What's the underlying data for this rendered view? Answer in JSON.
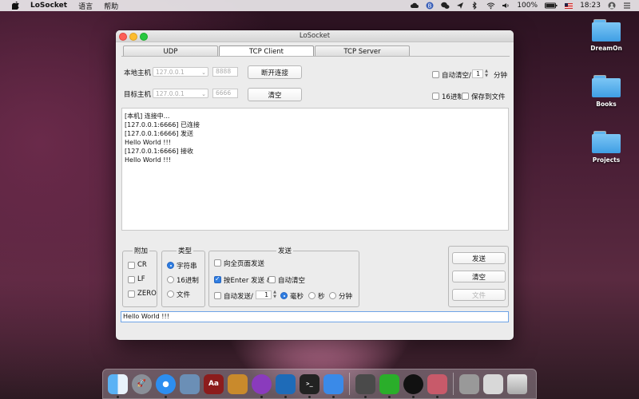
{
  "menubar": {
    "app_name": "LoSocket",
    "menus": [
      "语言",
      "帮助"
    ],
    "battery": "100%",
    "time": "18:23",
    "icons": [
      "apple-icon",
      "cloud-icon",
      "b-icon",
      "wechat-icon",
      "paperplane-icon",
      "bluetooth-icon",
      "wifi-icon",
      "volume-icon",
      "battery-icon",
      "flag-icon",
      "clock-icon",
      "user-icon",
      "list-icon"
    ]
  },
  "desktop": {
    "folders": [
      {
        "label": "DreamOn"
      },
      {
        "label": "Books"
      },
      {
        "label": "Projects"
      }
    ]
  },
  "window": {
    "title": "LoSocket",
    "tabs": [
      {
        "label": "UDP",
        "active": false
      },
      {
        "label": "TCP Client",
        "active": true
      },
      {
        "label": "TCP Server",
        "active": false
      }
    ],
    "local_host": {
      "label": "本地主机",
      "ip": "127.0.0.1",
      "port": "8888",
      "button": "断开连接"
    },
    "target_host": {
      "label": "目标主机",
      "ip": "127.0.0.1",
      "port": "6666",
      "button": "清空"
    },
    "auto_clear": {
      "label": "自动清空/",
      "value": "1",
      "unit": "分钟",
      "checked": false
    },
    "hex_display": {
      "label": "16进制",
      "checked": false
    },
    "save_to_file": {
      "label": "保存到文件",
      "checked": false
    },
    "log_lines": [
      "[本机] 连接中...",
      "[127.0.0.1:6666] 已连接",
      "[127.0.0.1:6666] 发送",
      "Hello World !!!",
      "[127.0.0.1:6666] 接收",
      "Hello World !!!"
    ],
    "append": {
      "title": "附加",
      "options": [
        {
          "label": "CR",
          "checked": false
        },
        {
          "label": "LF",
          "checked": false
        },
        {
          "label": "ZERO",
          "checked": false
        }
      ]
    },
    "type": {
      "title": "类型",
      "options": [
        {
          "label": "字符串",
          "selected": true
        },
        {
          "label": "16进制",
          "selected": false
        },
        {
          "label": "文件",
          "selected": false
        }
      ]
    },
    "send": {
      "title": "发送",
      "full_page": {
        "label": "向全页面发送",
        "checked": false
      },
      "enter_send": {
        "label": "按Enter 发送 &",
        "checked": true
      },
      "auto_clear_after": {
        "label": "自动清空",
        "checked": false
      },
      "auto_send": {
        "label": "自动发送/",
        "checked": false,
        "value": "1"
      },
      "units": [
        {
          "label": "毫秒",
          "selected": true
        },
        {
          "label": "秒",
          "selected": false
        },
        {
          "label": "分钟",
          "selected": false
        }
      ]
    },
    "buttons": {
      "send": "发送",
      "clear": "清空",
      "file": "文件"
    },
    "input_value": "Hello World !!!"
  },
  "dock": {
    "apps": [
      "Finder",
      "Launchpad",
      "Safari",
      "Preview",
      "Dictionary",
      "Calculator",
      "GitHub Desktop",
      "Visual Studio Code",
      "Terminal",
      "Xcode",
      "Activity Monitor",
      "WeChat",
      "QQ",
      "Network Utility",
      "Screenshot",
      "Mail",
      "Trash"
    ]
  }
}
